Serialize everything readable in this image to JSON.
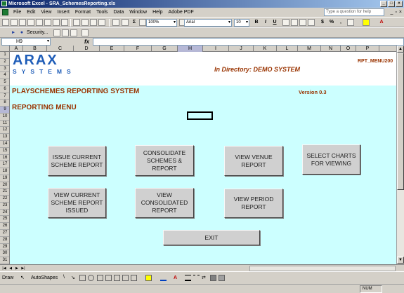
{
  "window": {
    "title": "Microsoft Excel - SRA_SchemesReporting.xls"
  },
  "menu": {
    "items": [
      "File",
      "Edit",
      "View",
      "Insert",
      "Format",
      "Tools",
      "Data",
      "Window",
      "Help",
      "Adobe PDF"
    ],
    "help_placeholder": "Type a question for help"
  },
  "toolbar": {
    "zoom": "100%",
    "font": "Arial",
    "size": "10",
    "security": "Security..."
  },
  "formula": {
    "cell": "H9",
    "fx": "fx"
  },
  "columns": [
    "A",
    "B",
    "C",
    "D",
    "E",
    "F",
    "G",
    "H",
    "I",
    "J",
    "K",
    "L",
    "M",
    "N",
    "O",
    "P"
  ],
  "selected_column": "H",
  "rows": [
    "1",
    "2",
    "3",
    "4",
    "5",
    "6",
    "7",
    "8",
    "9",
    "10",
    "11",
    "12",
    "13",
    "14",
    "15",
    "16",
    "17",
    "18",
    "19",
    "20",
    "21",
    "22",
    "23",
    "24",
    "25",
    "26",
    "27",
    "28",
    "29",
    "30",
    "31"
  ],
  "selected_row": "9",
  "sheet": {
    "logo_main": "ARAX",
    "logo_sub": "SYSTEMS",
    "report_id": "RPT_MENU200",
    "directory": "In Directory: DEMO SYSTEM",
    "system_title": "PLAYSCHEMES REPORTING SYSTEM",
    "version": "Version 0.3",
    "menu_title": "REPORTING MENU",
    "buttons": {
      "issue": "ISSUE CURRENT\nSCHEME REPORT",
      "consolidate": "CONSOLIDATE\nSCHEMES &\nREPORT",
      "venue": "VIEW VENUE\nREPORT",
      "charts": "SELECT CHARTS\nFOR VIEWING",
      "view_issued": "VIEW  CURRENT\nSCHEME REPORT\nISSUED",
      "view_consolidated": "VIEW\nCONSOLIDATED\nREPORT",
      "view_period": "VIEW PERIOD\nREPORT",
      "exit": "EXIT"
    }
  },
  "drawing": {
    "draw": "Draw",
    "autoshapes": "AutoShapes"
  },
  "status": {
    "num": "NUM"
  },
  "colors": {
    "sheet_bg": "#ccffff",
    "accent": "#993300",
    "logo": "#1f5db8"
  }
}
